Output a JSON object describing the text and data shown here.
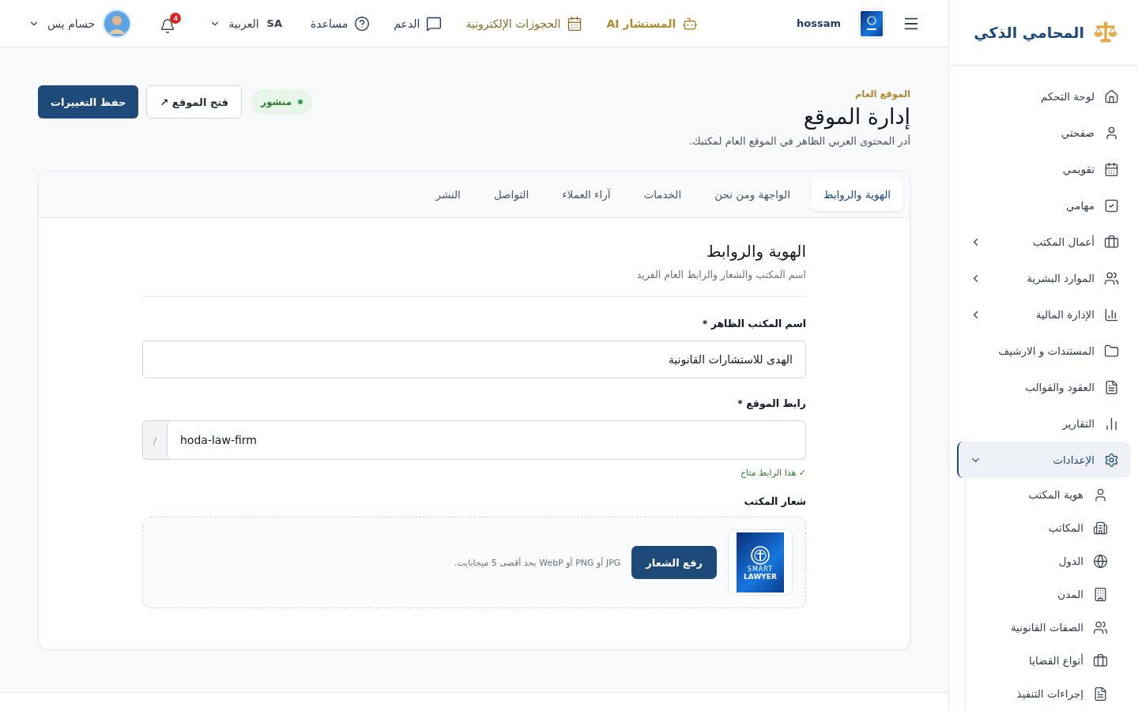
{
  "brand": {
    "name": "المحامي الذكي"
  },
  "topbar": {
    "user_short": "hossam",
    "links": [
      {
        "label": "المستشار AI",
        "kind": "ai"
      },
      {
        "label": "الحجوزات الإلكترونية",
        "kind": "bookings"
      },
      {
        "label": "الدعم",
        "kind": "support"
      },
      {
        "label": "مساعدة",
        "kind": "help"
      }
    ],
    "language": {
      "code": "SA",
      "label": "العربية"
    },
    "notifications": "4",
    "user_name": "حسام يس"
  },
  "sidebar": {
    "items": [
      {
        "label": "لوحة التحكم",
        "kind": "link",
        "selected": false
      },
      {
        "label": "صفحتي",
        "kind": "link",
        "selected": false
      },
      {
        "label": "تقويمي",
        "kind": "link",
        "selected": false
      },
      {
        "label": "مهامي",
        "kind": "link",
        "selected": false
      },
      {
        "label": "أعمال المكتب",
        "kind": "group",
        "selected": false,
        "expanded": false
      },
      {
        "label": "الموارد البشرية",
        "kind": "group",
        "selected": false,
        "expanded": false
      },
      {
        "label": "الإدارة المالية",
        "kind": "group",
        "selected": false,
        "expanded": false
      },
      {
        "label": "المستندات و الارشيف",
        "kind": "link",
        "selected": false
      },
      {
        "label": "العقود والقوالب",
        "kind": "link",
        "selected": false
      },
      {
        "label": "التقارير",
        "kind": "link",
        "selected": false
      },
      {
        "label": "الإعدادات",
        "kind": "group",
        "selected": true,
        "expanded": true,
        "children": [
          {
            "label": "هوية المكتب",
            "selected": false
          },
          {
            "label": "المكاتب",
            "selected": false
          },
          {
            "label": "الدول",
            "selected": false
          },
          {
            "label": "المدن",
            "selected": false
          },
          {
            "label": "الصفات القانونية",
            "selected": false
          },
          {
            "label": "أنواع القضايا",
            "selected": false
          },
          {
            "label": "إجراءات التنفيذ",
            "selected": false
          }
        ]
      }
    ]
  },
  "page": {
    "breadcrumb": "الموقع العام",
    "title": "إدارة الموقع",
    "subtitle": "أدر المحتوى العربي الظاهر في الموقع العام لمكتبك.",
    "status": {
      "label": "منشور",
      "published": true
    },
    "open_button": "فتح الموقع ↗",
    "save_button": "حفظ التغييرات"
  },
  "tabs": [
    {
      "label": "الهوية والروابط",
      "selected": true
    },
    {
      "label": "الواجهة ومن نحن",
      "selected": false
    },
    {
      "label": "الخدمات",
      "selected": false
    },
    {
      "label": "آراء العملاء",
      "selected": false
    },
    {
      "label": "التواصل",
      "selected": false
    },
    {
      "label": "النشر",
      "selected": false
    }
  ],
  "section": {
    "title": "الهوية والروابط",
    "subtitle": "اسم المكتب والشعار والرابط العام الفريد",
    "name_field": {
      "label": "اسم المكتب الظاهر *",
      "value": "الهدى للاستشارات القانونية"
    },
    "slug_field": {
      "label": "رابط الموقع *",
      "prefix": "/",
      "value": "hoda-law-firm",
      "hint": "✓ هذا الرابط متاح",
      "available": true
    },
    "logo": {
      "label": "شعار المكتب",
      "caption_top": "SMART",
      "caption_bottom": "LAWYER",
      "upload_button": "رفع الشعار",
      "hint": "JPG أو PNG أو WebP بحد أقصى 5 ميجابايت."
    }
  }
}
